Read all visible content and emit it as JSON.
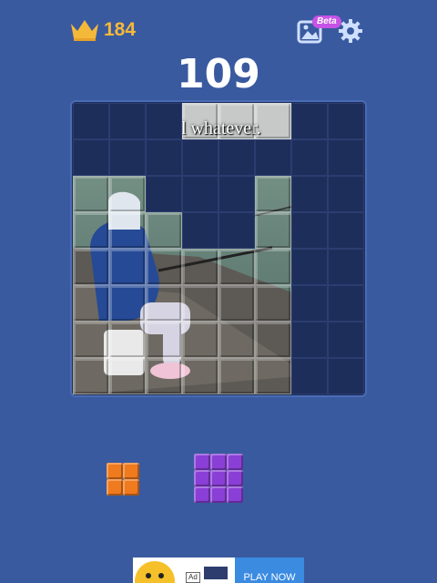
{
  "header": {
    "best_score": "184",
    "beta_label": "Beta",
    "icons": [
      "crown-icon",
      "photo-puzzle-icon",
      "gear-icon"
    ]
  },
  "score": "109",
  "board": {
    "size": 8,
    "caption_text": "l whatever.",
    "filled_cells": [
      [
        0,
        3
      ],
      [
        0,
        4
      ],
      [
        0,
        5
      ],
      [
        2,
        0
      ],
      [
        2,
        1
      ],
      [
        2,
        5
      ],
      [
        3,
        0
      ],
      [
        3,
        1
      ],
      [
        3,
        2
      ],
      [
        3,
        5
      ],
      [
        4,
        0
      ],
      [
        4,
        1
      ],
      [
        4,
        2
      ],
      [
        4,
        3
      ],
      [
        4,
        4
      ],
      [
        4,
        5
      ],
      [
        5,
        0
      ],
      [
        5,
        1
      ],
      [
        5,
        2
      ],
      [
        5,
        3
      ],
      [
        5,
        4
      ],
      [
        5,
        5
      ],
      [
        6,
        0
      ],
      [
        6,
        1
      ],
      [
        6,
        2
      ],
      [
        6,
        3
      ],
      [
        6,
        4
      ],
      [
        6,
        5
      ],
      [
        7,
        0
      ],
      [
        7,
        1
      ],
      [
        7,
        2
      ],
      [
        7,
        3
      ],
      [
        7,
        4
      ],
      [
        7,
        5
      ]
    ]
  },
  "pieces": [
    {
      "name": "orange-2x2-piece",
      "rows": 2,
      "cols": 2,
      "color": "#f07a1e"
    },
    {
      "name": "purple-3x3-piece",
      "rows": 3,
      "cols": 3,
      "color": "#8a3fd6"
    }
  ],
  "ad": {
    "cta": "PLAY NOW",
    "badge": "Ad"
  },
  "colors": {
    "background": "#3a5aa0",
    "board": "#1e2e5a",
    "crown": "#f5b93a",
    "accent_beta": "#c653e6"
  }
}
